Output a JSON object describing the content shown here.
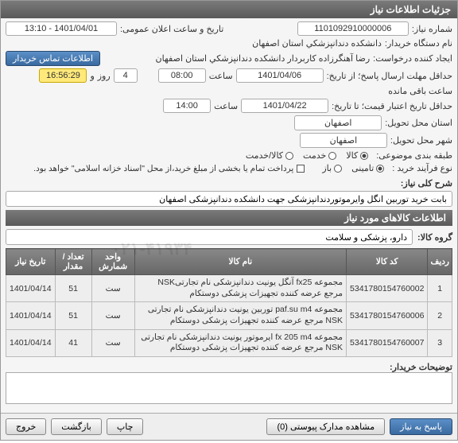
{
  "panel_title": "جزئیات اطلاعات نیاز",
  "labels": {
    "need_no": "شماره نیاز:",
    "buyer_org": "نام دستگاه خریدار:",
    "requester": "ایجاد کننده درخواست:",
    "deadline": "حداقل مهلت ارسال پاسخ؛ از تاریخ:",
    "valid_from": "حداقل تاریخ اعتبار قیمت؛ تا تاریخ:",
    "exec_province": "استان محل تحویل:",
    "exec_city": "شهر محل تحویل:",
    "classification": "طبقه بندی موضوعی:",
    "process_type": "نوع فرآیند خرید :",
    "announce_dt": "تاریخ و ساعت اعلان عمومی:",
    "contact_btn": "اطلاعات تماس خریدار",
    "hour": "ساعت",
    "and": "و",
    "day": "روز",
    "remaining": "ساعت باقی مانده",
    "goods": "کالا",
    "service": "خدمت",
    "goods_service": "کالا/خدمت",
    "guarantee": "تامینی",
    "open": "باز",
    "payment_note": "پرداخت تمام یا بخشی از مبلغ خرید،از محل \"اسناد خزانه اسلامی\" خواهد بود.",
    "desc_label": "شرح کلی نیاز:",
    "goods_section": "اطلاعات کالاهای مورد نیاز",
    "goods_group": "گروه کالا:",
    "comments_label": "توضیحات خریدار:"
  },
  "values": {
    "need_no": "1101092910000006",
    "buyer_org": "دانشکده دندانپزشکي استان اصفهان",
    "requester": "رضا آهنگرزاده کاربردار دانشکده دندانپزشکي استان اصفهان",
    "deadline_date": "1401/04/06",
    "deadline_time": "08:00",
    "days_left": "4",
    "time_left": "16:56:29",
    "valid_date": "1401/04/22",
    "valid_time": "14:00",
    "province": "اصفهان",
    "city": "اصفهان",
    "announce_dt": "1401/04/01 - 13:10",
    "description": "بابت خرید توربین انگل وایرموتوردندانپزشکی جهت دانشکده دندانپزشکی اصفهان",
    "goods_group": "دارو، پزشکی و سلامت"
  },
  "table": {
    "headers": [
      "ردیف",
      "کد کالا",
      "نام کالا",
      "واحد شمارش",
      "تعداد / مقدار",
      "تاریخ نیاز"
    ],
    "rows": [
      {
        "idx": "1",
        "code": "5341780154760002",
        "name": "مجموعه fx25 آنگل یونیت دندانپزشکی نام تجارتیNSK مرجع عرضه کننده تجهیزات پزشکی دوستکام",
        "unit": "ست",
        "qty": "51",
        "date": "1401/04/14"
      },
      {
        "idx": "2",
        "code": "5341780154760006",
        "name": "مجموعه paf.su m4 توربین یونیت دندانپزشکی نام تجارتی NSK مرجع عرضه کننده تجهیزات پزشکی دوستکام",
        "unit": "ست",
        "qty": "51",
        "date": "1401/04/14"
      },
      {
        "idx": "3",
        "code": "5341780154760007",
        "name": "مجموعه fx 205 m4 ایرموتور یونیت دندانپزشکی نام تجارتی NSK مرجع عرضه کننده تجهیزات پزشکی دوستکام",
        "unit": "ست",
        "qty": "41",
        "date": "1401/04/14"
      }
    ]
  },
  "footer": {
    "respond": "پاسخ به نیاز",
    "attachments": "مشاهده مدارک پیوستی (0)",
    "print": "چاپ",
    "back": "بازگشت",
    "exit": "خروج"
  },
  "watermark": "۰۲۱-۴۱۹۳۴"
}
